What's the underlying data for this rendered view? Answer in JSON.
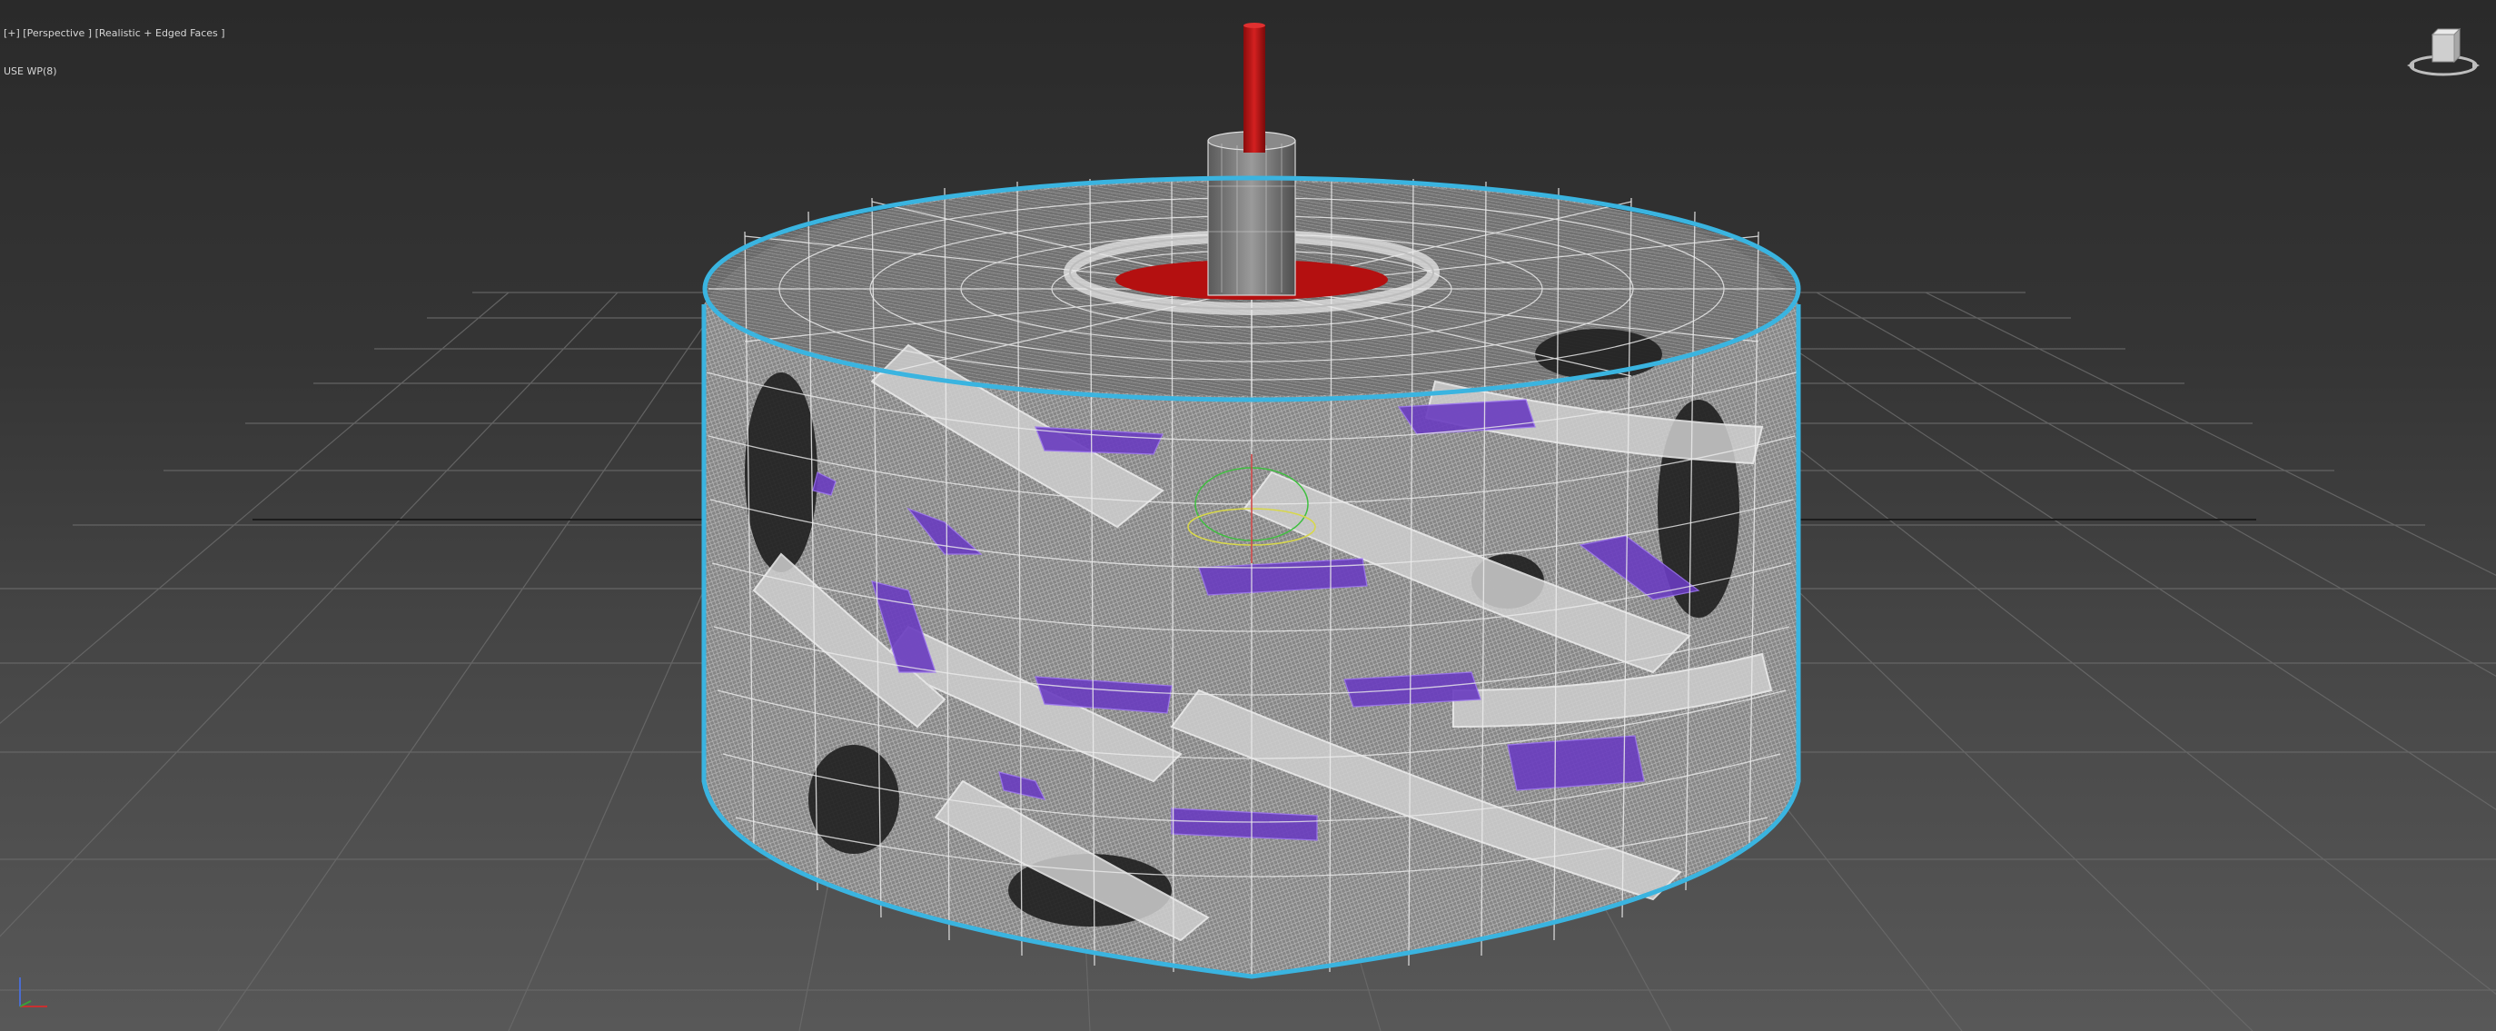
{
  "viewport": {
    "label_line1": "[+] [Perspective ] [Realistic + Edged Faces ]",
    "label_line2": "USE WP(8)"
  },
  "icons": {
    "viewcube": "viewcube-icon",
    "axis_tripod": "axis-tripod-icon"
  },
  "colors": {
    "background_top": "#2a2a2a",
    "background_bottom": "#585858",
    "grid_line": "#6a6a6a",
    "selection_outline": "#38b6e0",
    "wireframe": "#e8e8e8",
    "mesh_fill": "#9a9a9a",
    "purple_faces": "#6a3cc0",
    "red_shaft": "#c01818"
  }
}
